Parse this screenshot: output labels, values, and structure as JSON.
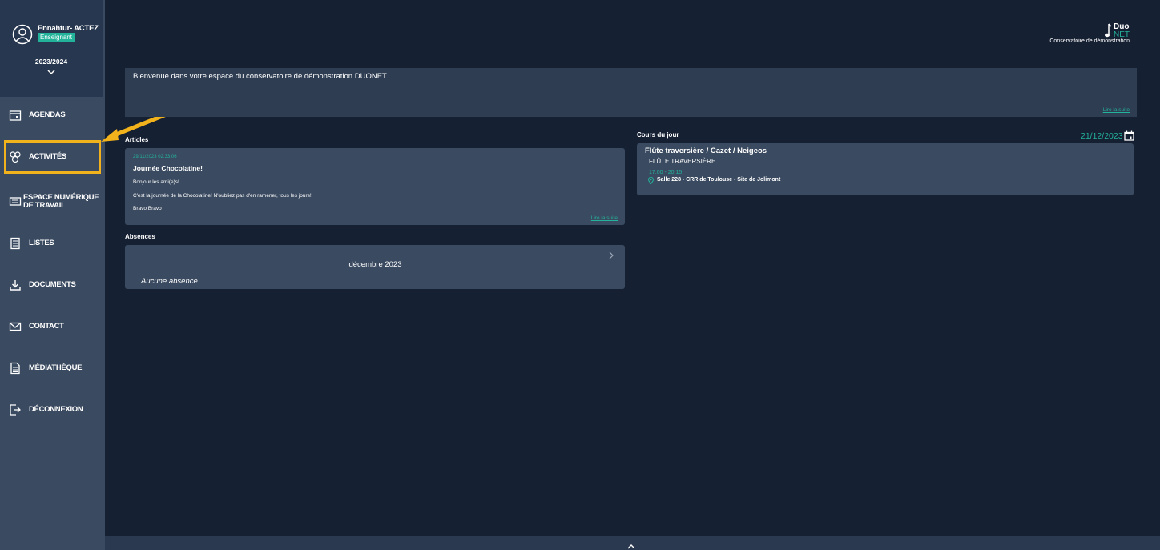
{
  "user": {
    "name": "Ennahtur- ACTEZ",
    "role": "Enseignant",
    "year": "2023/2024"
  },
  "nav": [
    {
      "label": "AGENDAS",
      "icon": "agenda-icon"
    },
    {
      "label": "ACTIVITÉS",
      "icon": "activities-icon"
    },
    {
      "label": "ESPACE NUMÉRIQUE",
      "label2": "DE TRAVAIL",
      "icon": "workspace-icon"
    },
    {
      "label": "LISTES",
      "icon": "lists-icon"
    },
    {
      "label": "DOCUMENTS",
      "icon": "download-icon"
    },
    {
      "label": "CONTACT",
      "icon": "mail-icon"
    },
    {
      "label": "MÉDIATHÈQUE",
      "icon": "library-icon"
    },
    {
      "label": "DÉCONNEXION",
      "icon": "logout-icon"
    }
  ],
  "brand": {
    "duo": "Duo",
    "net": "NET",
    "subtitle": "Conservatoire de démonstration"
  },
  "welcome": {
    "text": "Bienvenue dans votre espace du conservatoire de démonstration DUONET",
    "read_more": "Lire la suite"
  },
  "articles": {
    "title": "Articles",
    "date": "29/11/2023 02:33:06",
    "headline": "Journée Chocolatine!",
    "line1": "Bonjour les ami(e)s!",
    "line2": "C'est la journée de la Chocolatine! N'oubliez pas d'en ramener, tous les jours!",
    "line3": "Bravo Bravo",
    "read_more": "Lire la suite"
  },
  "absences": {
    "title": "Absences",
    "month": "décembre 2023",
    "empty": "Aucune absence"
  },
  "courses": {
    "title": "Cours du jour",
    "date": "21/12/2023",
    "course_title": "Flûte traversière / Cazet / Neigeos",
    "subject": "FLÛTE TRAVERSIÈRE",
    "time": "17:00 - 20:15",
    "place": "Salle 228 - CRR de Toulouse - Site de Jolimont"
  },
  "colors": {
    "accent": "#23b39b",
    "highlight": "#f2b21b",
    "background": "#162033",
    "sidebar": "#3a4a60"
  }
}
